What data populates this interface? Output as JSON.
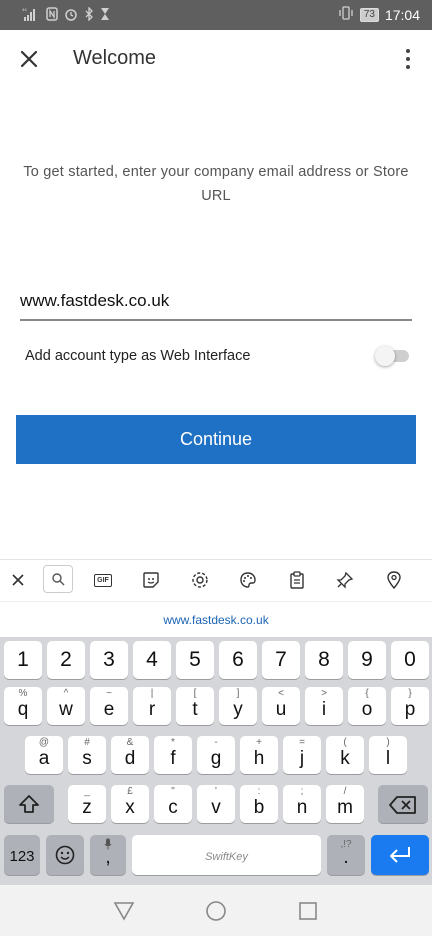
{
  "status_bar": {
    "signal_label": "⁴⁶",
    "battery": "73",
    "time": "17:04"
  },
  "app_bar": {
    "title": "Welcome"
  },
  "intro_text": "To get started, enter your company email address or Store URL",
  "email_field": {
    "value": "www.fastdesk.co.uk"
  },
  "web_interface_toggle": {
    "label": "Add account type as Web Interface",
    "on": false
  },
  "continue_button": {
    "label": "Continue",
    "color": "#1f71c6"
  },
  "keyboard_toolbar": {
    "gif_label": "GIF"
  },
  "suggestion": "www.fastdesk.co.uk",
  "keyboard": {
    "number_row": [
      "1",
      "2",
      "3",
      "4",
      "5",
      "6",
      "7",
      "8",
      "9",
      "0"
    ],
    "row1": [
      {
        "key": "q",
        "hint": "%"
      },
      {
        "key": "w",
        "hint": "^"
      },
      {
        "key": "e",
        "hint": "~"
      },
      {
        "key": "r",
        "hint": "|"
      },
      {
        "key": "t",
        "hint": "["
      },
      {
        "key": "y",
        "hint": "]"
      },
      {
        "key": "u",
        "hint": "<"
      },
      {
        "key": "i",
        "hint": ">"
      },
      {
        "key": "o",
        "hint": "{"
      },
      {
        "key": "p",
        "hint": "}"
      }
    ],
    "row2": [
      {
        "key": "a",
        "hint": "@"
      },
      {
        "key": "s",
        "hint": "#"
      },
      {
        "key": "d",
        "hint": "&"
      },
      {
        "key": "f",
        "hint": "*"
      },
      {
        "key": "g",
        "hint": "-"
      },
      {
        "key": "h",
        "hint": "+"
      },
      {
        "key": "j",
        "hint": "="
      },
      {
        "key": "k",
        "hint": "("
      },
      {
        "key": "l",
        "hint": ")"
      }
    ],
    "row3": [
      {
        "key": "z",
        "hint": "_"
      },
      {
        "key": "x",
        "hint": "£"
      },
      {
        "key": "c",
        "hint": "\""
      },
      {
        "key": "v",
        "hint": "'"
      },
      {
        "key": "b",
        "hint": ":"
      },
      {
        "key": "n",
        "hint": ";"
      },
      {
        "key": "m",
        "hint": "/"
      }
    ],
    "symbols_key": "123",
    "comma_key": ",",
    "period_key": ".",
    "period_hint": ",!?",
    "space_label": "SwiftKey",
    "enter_color": "#1a7bf0"
  }
}
